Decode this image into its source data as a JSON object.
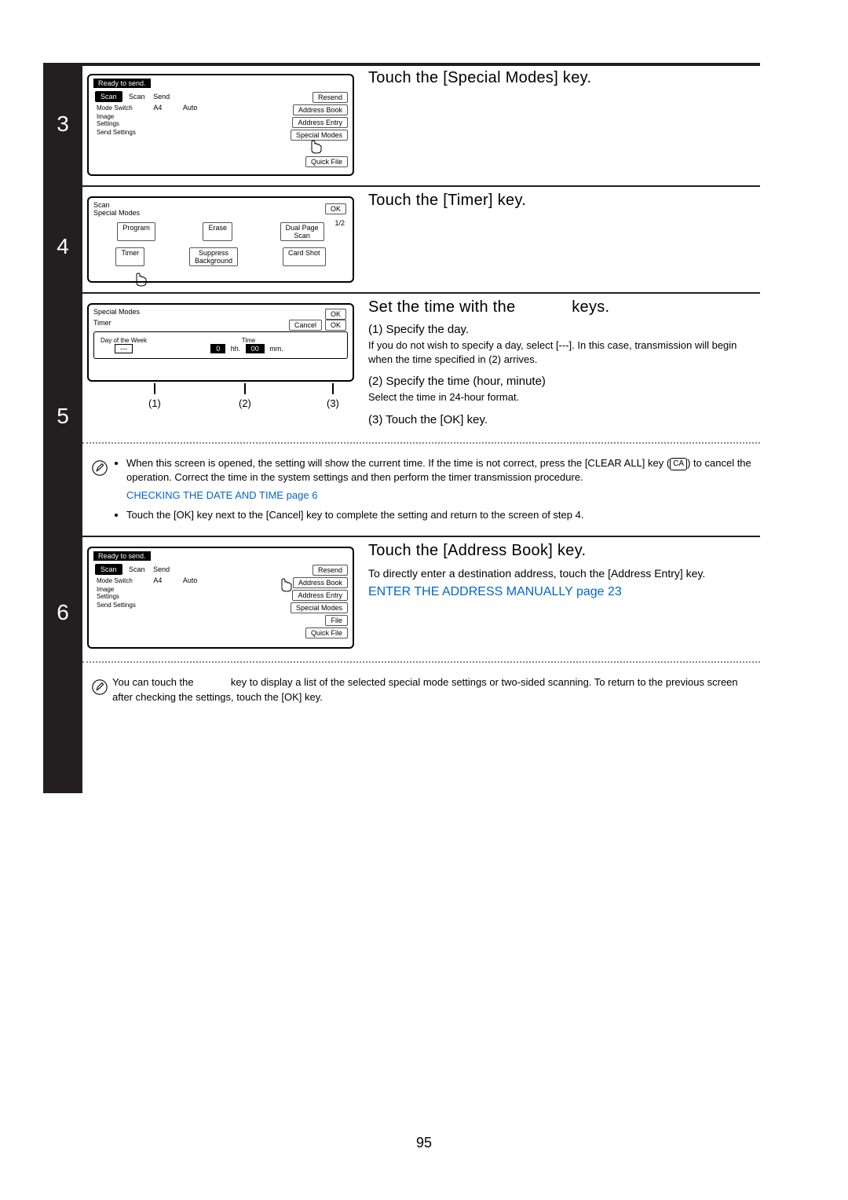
{
  "page_number": "95",
  "step3": {
    "num": "3",
    "title": "Touch the [Special Modes] key.",
    "ui": {
      "status": "Ready to send.",
      "scan_btn": "Scan",
      "scan_tab": "Scan",
      "send_tab": "Send",
      "mode_switch": "Mode Switch",
      "a4": "A4",
      "auto": "Auto",
      "image_settings": "Image\nSettings",
      "send_settings": "Send Settings",
      "resend": "Resend",
      "address_book": "Address Book",
      "address_entry": "Address Entry",
      "special_modes": "Special Modes",
      "quick_file": "Quick File"
    }
  },
  "step4": {
    "num": "4",
    "title": "Touch the [Timer] key.",
    "ui": {
      "breadcrumb": "Scan\nSpecial Modes",
      "ok": "OK",
      "page_counter": "1/2",
      "program": "Program",
      "erase": "Erase",
      "dual_page": "Dual Page\nScan",
      "timer": "Timer",
      "suppress": "Suppress\nBackground",
      "card_shot": "Card Shot"
    }
  },
  "step5": {
    "num": "5",
    "title_a": "Set the time with the",
    "title_b": "keys.",
    "ui": {
      "breadcrumb": "Special Modes",
      "ok": "OK",
      "timer": "Timer",
      "cancel": "Cancel",
      "ok2": "OK",
      "day_label": "Day of the Week",
      "time_label": "Time",
      "day_value": "---",
      "hh_value": "0",
      "hh_label": "hh.",
      "mm_value": "00",
      "mm_label": "mm.",
      "cue1": "(1)",
      "cue2": "(2)",
      "cue3": "(3)"
    },
    "sub1": {
      "head": "(1)  Specify the day.",
      "desc": "If you do not wish to specify a day, select [---]. In this case, transmission will begin when the time specified in (2) arrives."
    },
    "sub2": {
      "head": "(2)  Specify the time (hour, minute)",
      "desc": "Select the time in 24-hour format."
    },
    "sub3": {
      "head": "(3)  Touch the [OK] key."
    },
    "note1_a": "When this screen is opened, the setting will show the current time. If the time is not correct, press the [CLEAR ALL] key (",
    "note1_b": ") to cancel the operation. Correct the time in the system settings and then perform the timer transmission procedure.",
    "note1_ca": "CA",
    "note1_link": "CHECKING THE DATE AND TIME page 6",
    "note2": "Touch the [OK] key next to the [Cancel] key to complete the setting and return to the screen of step 4."
  },
  "step6": {
    "num": "6",
    "title": "Touch the [Address Book] key.",
    "desc_a": "To directly enter a destination address, touch the [Address Entry] key.",
    "link": "ENTER THE ADDRESS MANUALLY page 23",
    "ui": {
      "status": "Ready to send.",
      "scan_btn": "Scan",
      "scan_tab": "Scan",
      "send_tab": "Send",
      "mode_switch": "Mode Switch",
      "a4": "A4",
      "auto": "Auto",
      "image_settings": "Image\nSettings",
      "send_settings": "Send Settings",
      "resend": "Resend",
      "address_book": "Address Book",
      "address_entry": "Address Entry",
      "special_modes": "Special Modes",
      "file": "File",
      "quick_file": "Quick File"
    },
    "note_a": "You can touch the",
    "note_b": "key to display a list of the selected special mode settings or two-sided scanning. To return to the previous screen after checking the settings, touch the [OK] key."
  }
}
